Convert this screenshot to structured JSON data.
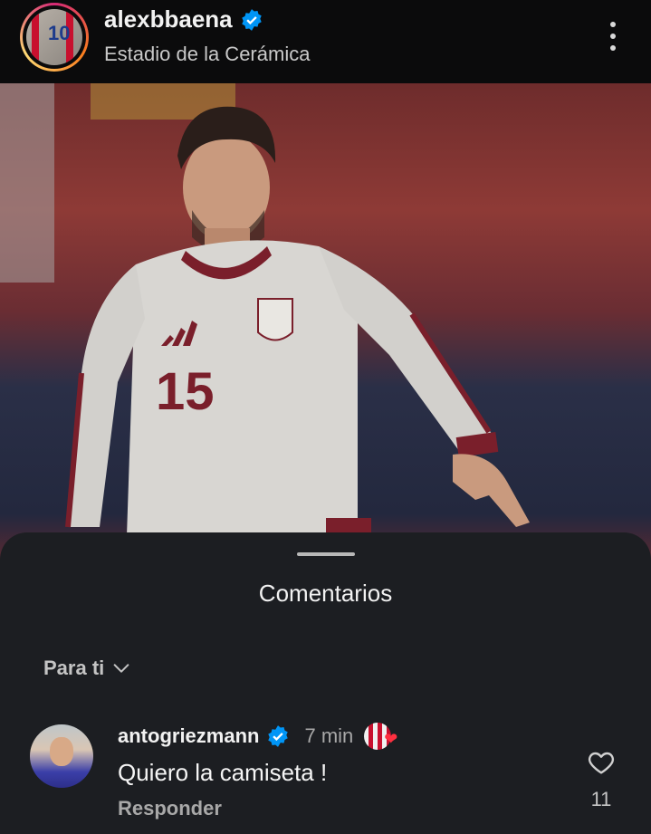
{
  "header": {
    "username": "alexbbaena",
    "location": "Estadio de la Cerámica",
    "avatar_icon": "profile-avatar",
    "more_icon": "more-vertical-icon"
  },
  "photo": {
    "jersey_number": "15"
  },
  "comments_sheet": {
    "title": "Comentarios",
    "filter_label": "Para ti",
    "comments": [
      {
        "username": "antogriezmann",
        "verified": true,
        "time": "7 min",
        "text": "Quiero la camiseta !",
        "reply_label": "Responder",
        "likes": "11"
      }
    ]
  },
  "colors": {
    "verified": "#0095f6",
    "heart": "#ff3040",
    "sheet_bg": "#1c1e22"
  }
}
